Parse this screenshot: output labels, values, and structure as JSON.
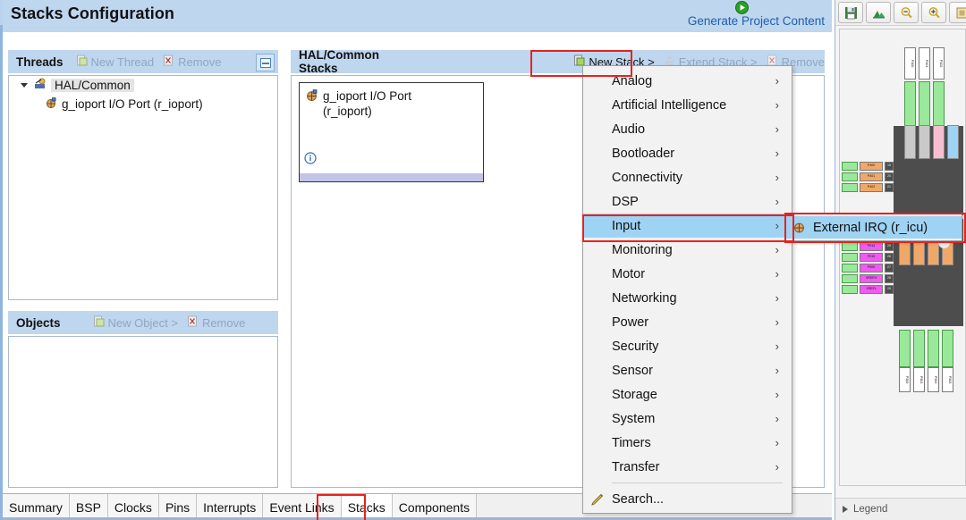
{
  "header": {
    "title": "Stacks Configuration",
    "generate_link": "Generate Project Content",
    "generate_icon": "play-circle-green-icon"
  },
  "diagram_panel": {
    "toolbar": [
      {
        "name": "save-icon",
        "tooltip": "Save"
      },
      {
        "name": "fit-to-view-icon",
        "tooltip": "Fit to View"
      },
      {
        "name": "zoom-out-icon",
        "tooltip": "Zoom Out"
      },
      {
        "name": "zoom-in-icon",
        "tooltip": "Zoom In"
      },
      {
        "name": "package-view-icon",
        "tooltip": "Package View"
      }
    ],
    "legend_label": "Legend",
    "legend_expander": "triangle-right-icon"
  },
  "threads_panel": {
    "title": "Threads",
    "actions": [
      {
        "label": "New Thread",
        "icon": "new-thread-icon",
        "enabled": false
      },
      {
        "label": "Remove",
        "icon": "remove-icon",
        "enabled": false
      }
    ],
    "collapse_icon": "collapse-all-icon",
    "tree": [
      {
        "label": "HAL/Common",
        "icon": "thread-icon",
        "expander": "chevron-down-icon",
        "selected": true,
        "depth": 0
      },
      {
        "label": "g_ioport I/O Port (r_ioport)",
        "icon": "module-icon",
        "selected": false,
        "depth": 1
      }
    ]
  },
  "objects_panel": {
    "title": "Objects",
    "actions": [
      {
        "label": "New Object >",
        "icon": "new-object-icon",
        "enabled": false
      },
      {
        "label": "Remove",
        "icon": "remove-icon",
        "enabled": false
      }
    ],
    "items": []
  },
  "stacks_panel": {
    "title": "HAL/Common Stacks",
    "actions": [
      {
        "label": "New Stack >",
        "icon": "new-stack-icon",
        "enabled": true
      },
      {
        "label": "Extend Stack >",
        "icon": "extend-stack-icon",
        "enabled": false
      },
      {
        "label": "Remove",
        "icon": "remove-icon",
        "enabled": false
      }
    ],
    "cards": [
      {
        "title_line1": "g_ioport I/O Port",
        "title_line2": "(r_ioport)",
        "icon": "module-icon",
        "info_icon": "info-icon"
      }
    ]
  },
  "new_stack_menu": {
    "items": [
      {
        "label": "Analog",
        "has_submenu": true,
        "highlight": false
      },
      {
        "label": "Artificial Intelligence",
        "has_submenu": true,
        "highlight": false
      },
      {
        "label": "Audio",
        "has_submenu": true,
        "highlight": false
      },
      {
        "label": "Bootloader",
        "has_submenu": true,
        "highlight": false
      },
      {
        "label": "Connectivity",
        "has_submenu": true,
        "highlight": false
      },
      {
        "label": "DSP",
        "has_submenu": true,
        "highlight": false
      },
      {
        "label": "Input",
        "has_submenu": true,
        "highlight": true
      },
      {
        "label": "Monitoring",
        "has_submenu": true,
        "highlight": false
      },
      {
        "label": "Motor",
        "has_submenu": true,
        "highlight": false
      },
      {
        "label": "Networking",
        "has_submenu": true,
        "highlight": false
      },
      {
        "label": "Power",
        "has_submenu": true,
        "highlight": false
      },
      {
        "label": "Security",
        "has_submenu": true,
        "highlight": false
      },
      {
        "label": "Sensor",
        "has_submenu": true,
        "highlight": false
      },
      {
        "label": "Storage",
        "has_submenu": true,
        "highlight": false
      },
      {
        "label": "System",
        "has_submenu": true,
        "highlight": false
      },
      {
        "label": "Timers",
        "has_submenu": true,
        "highlight": false
      },
      {
        "label": "Transfer",
        "has_submenu": true,
        "highlight": false
      }
    ],
    "search_item": {
      "label": "Search...",
      "icon": "search-pencil-icon"
    },
    "submenu_items": [
      {
        "label": "External IRQ (r_icu)",
        "icon": "module-icon",
        "highlight": true
      }
    ]
  },
  "bottom_tabs": [
    {
      "label": "Summary",
      "active": false
    },
    {
      "label": "BSP",
      "active": false
    },
    {
      "label": "Clocks",
      "active": false
    },
    {
      "label": "Pins",
      "active": false
    },
    {
      "label": "Interrupts",
      "active": false
    },
    {
      "label": "Event Links",
      "active": false
    },
    {
      "label": "Stacks",
      "active": true
    },
    {
      "label": "Components",
      "active": false
    }
  ],
  "annotations": {
    "highlight_color": "#e8221e",
    "boxes": [
      {
        "name": "new-stack-button-highlight"
      },
      {
        "name": "input-menu-item-highlight"
      },
      {
        "name": "external-irq-submenu-highlight"
      },
      {
        "name": "stacks-tab-highlight"
      }
    ]
  },
  "colors": {
    "header_band": "#bfd6ef",
    "menu_highlight": "#9fd3f3",
    "link": "#1e5fa8",
    "card_footer": "#c3c3e6"
  }
}
